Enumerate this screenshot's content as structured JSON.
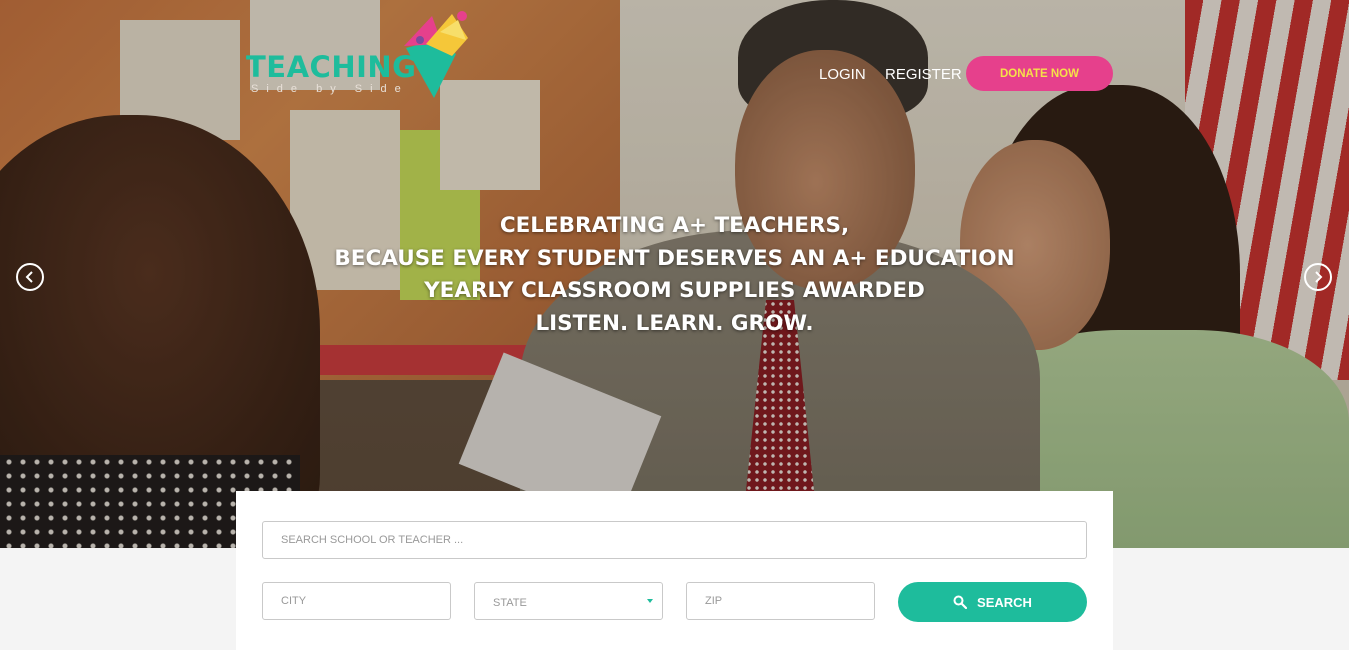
{
  "header": {
    "logo_word": "TEACHING",
    "logo_sub": "Side by Side",
    "nav": {
      "login": "LOGIN",
      "register": "REGISTER"
    },
    "donate_label": "DONATE NOW"
  },
  "hero": {
    "lines": [
      "CELEBRATING A+ TEACHERS,",
      "BECAUSE EVERY STUDENT DESERVES AN A+ EDUCATION",
      "YEARLY CLASSROOM SUPPLIES AWARDED",
      "LISTEN. LEARN. GROW."
    ],
    "prev_icon": "chevron-left-icon",
    "next_icon": "chevron-right-icon"
  },
  "search": {
    "main_placeholder": "SEARCH SCHOOL OR TEACHER ...",
    "city_placeholder": "CITY",
    "state_value": "STATE",
    "zip_placeholder": "ZIP",
    "button_label": "SEARCH",
    "button_icon": "search-icon"
  },
  "colors": {
    "teal": "#1ebc9c",
    "pink": "#e6408c",
    "yellow": "#f5e04a"
  }
}
